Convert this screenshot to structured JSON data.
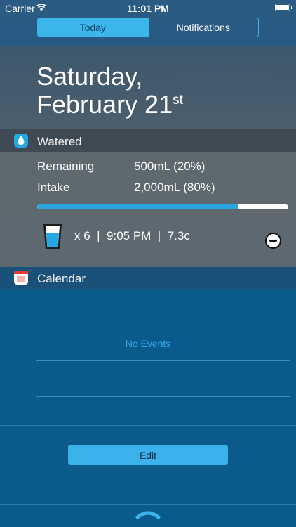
{
  "status_bar": {
    "carrier": "Carrier",
    "time": "11:01 PM"
  },
  "tabs": {
    "today": "Today",
    "notifications": "Notifications"
  },
  "date": {
    "weekday": "Saturday,",
    "month_day": "February 21",
    "suffix": "st"
  },
  "watered": {
    "title": "Watered",
    "remaining_label": "Remaining",
    "remaining_value": "500mL (20%)",
    "intake_label": "Intake",
    "intake_value": "2,000mL (80%)",
    "progress_fraction": 0.8,
    "entry": {
      "count": "x 6",
      "time": "9:05 PM",
      "amount": "7.3c"
    }
  },
  "calendar": {
    "title": "Calendar",
    "empty_text": "No Events"
  },
  "edit_label": "Edit",
  "colors": {
    "accent": "#3cb2ea",
    "progress": "#2aa7e3"
  },
  "icons": [
    "wifi-icon",
    "battery-icon",
    "water-drop-icon",
    "calendar-icon",
    "water-glass-icon",
    "minus-circle-icon",
    "pull-handle-icon"
  ]
}
